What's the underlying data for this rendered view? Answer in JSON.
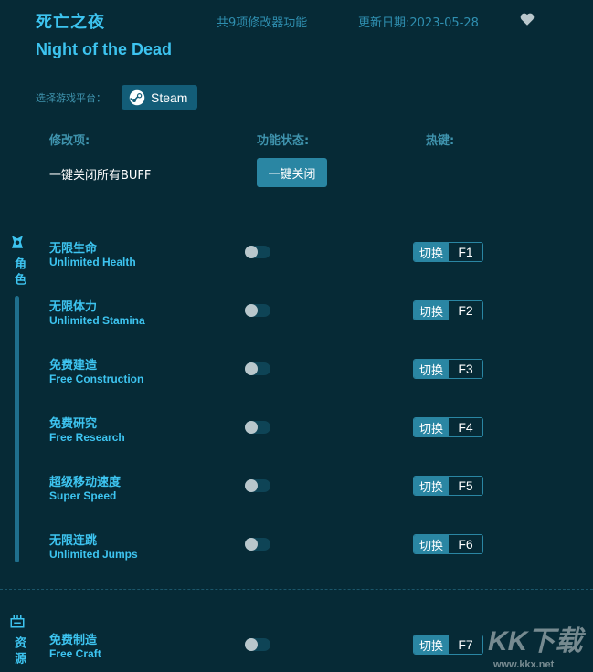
{
  "header": {
    "title_cn": "死亡之夜",
    "title_en": "Night of the Dead",
    "feature_count": "共9项修改器功能",
    "update_date": "更新日期:2023-05-28",
    "favorite_icon": "heart-icon"
  },
  "platform": {
    "label": "选择游戏平台：",
    "button_label": "Steam",
    "icon": "steam-icon"
  },
  "columns": {
    "option": "修改项:",
    "status": "功能状态:",
    "hotkey": "热键:"
  },
  "all_off": {
    "label": "一键关闭所有BUFF",
    "button_label": "一键关闭"
  },
  "categories": [
    {
      "name": "角色",
      "icon": "character-icon",
      "options": [
        {
          "cn": "无限生命",
          "en": "Unlimited Health",
          "enabled": false,
          "switch": "切换",
          "key": "F1"
        },
        {
          "cn": "无限体力",
          "en": "Unlimited Stamina",
          "enabled": false,
          "switch": "切换",
          "key": "F2"
        },
        {
          "cn": "免费建造",
          "en": "Free Construction",
          "enabled": false,
          "switch": "切换",
          "key": "F3"
        },
        {
          "cn": "免费研究",
          "en": "Free Research",
          "enabled": false,
          "switch": "切换",
          "key": "F4"
        },
        {
          "cn": "超级移动速度",
          "en": "Super Speed",
          "enabled": false,
          "switch": "切换",
          "key": "F5"
        },
        {
          "cn": "无限连跳",
          "en": "Unlimited Jumps",
          "enabled": false,
          "switch": "切换",
          "key": "F6"
        }
      ]
    },
    {
      "name": "资源",
      "icon": "resources-icon",
      "options": [
        {
          "cn": "免费制造",
          "en": "Free Craft",
          "enabled": false,
          "switch": "切换",
          "key": "F7"
        }
      ]
    }
  ],
  "watermark": {
    "logo": "KK下载",
    "url": "www.kkx.net"
  },
  "colors": {
    "background": "#062a36",
    "accent": "#3dc4f0",
    "muted": "#3f93ad",
    "button": "#2a86a3"
  }
}
